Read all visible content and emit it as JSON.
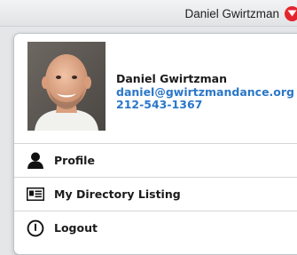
{
  "header": {
    "user_name": "Daniel Gwirtzman",
    "caret_icon": "chevron-down-circle-icon"
  },
  "profile": {
    "name": "Daniel Gwirtzman",
    "email": "daniel@gwirtzmandance.org",
    "phone": "212-543-1367",
    "avatar_icon": "avatar-photo"
  },
  "menu": {
    "items": [
      {
        "label": "Profile",
        "icon": "person-icon"
      },
      {
        "label": "My Directory Listing",
        "icon": "id-card-icon"
      },
      {
        "label": "Logout",
        "icon": "power-icon"
      }
    ]
  },
  "colors": {
    "accent_red": "#e3262c",
    "link_blue": "#2b77c9",
    "text_dark": "#1b1b1b"
  }
}
